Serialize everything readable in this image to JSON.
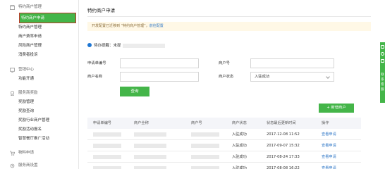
{
  "sidebar": {
    "sections": [
      {
        "label": "特约商户管理",
        "icon": "store-icon"
      },
      {
        "label": "营销中心",
        "icon": "marketing-icon"
      },
      {
        "label": "服务商奖励",
        "icon": "reward-icon"
      },
      {
        "label": "物料申请",
        "icon": "cart-icon"
      },
      {
        "label": "服务商设置",
        "icon": "settings-icon"
      }
    ],
    "items": [
      {
        "label": "特约商户申请",
        "selected": true
      },
      {
        "label": "特约商户管理"
      },
      {
        "label": "商户费率申请"
      },
      {
        "label": "风险商户管理"
      },
      {
        "label": "消费者投诉"
      },
      {
        "label": "功能开通"
      },
      {
        "label": "奖励管理"
      },
      {
        "label": "奖励查询"
      },
      {
        "label": "奖励行业商户管理"
      },
      {
        "label": "奖励活动报名"
      },
      {
        "label": "智慧餐厅推广活动"
      }
    ]
  },
  "main": {
    "title": "特约商户申请",
    "notice": {
      "text": "开发配置已迁移到 “特约商户管理”，",
      "link": "前往配置"
    },
    "tip": {
      "text": "待办提醒：未提"
    },
    "form": {
      "apply_no_label": "申请单编号",
      "merchant_no_label": "商户号",
      "merchant_name_label": "商户名称",
      "status_label": "商户状态",
      "status_value": "入驻成功",
      "query_button": "查询"
    },
    "add_button": "+ 新增商户",
    "table": {
      "columns": [
        "申请单编号",
        "商户全称",
        "商户号",
        "商户状态",
        "状态最后更新时间",
        "操作"
      ],
      "rows": [
        {
          "status": "入驻成功",
          "time": "2017-12-08 11:52",
          "action": "查看申请"
        },
        {
          "status": "入驻成功",
          "time": "2017-09-07 15:32",
          "action": "查看申请"
        },
        {
          "status": "入驻成功",
          "time": "2017-08-24 17:33",
          "action": "查看申请"
        },
        {
          "status": "入驻成功",
          "time": "2017-08-08 16:22",
          "action": "查看申请"
        }
      ]
    }
  },
  "right_bar": {
    "text": [
      "联",
      "系",
      "客",
      "服"
    ]
  }
}
